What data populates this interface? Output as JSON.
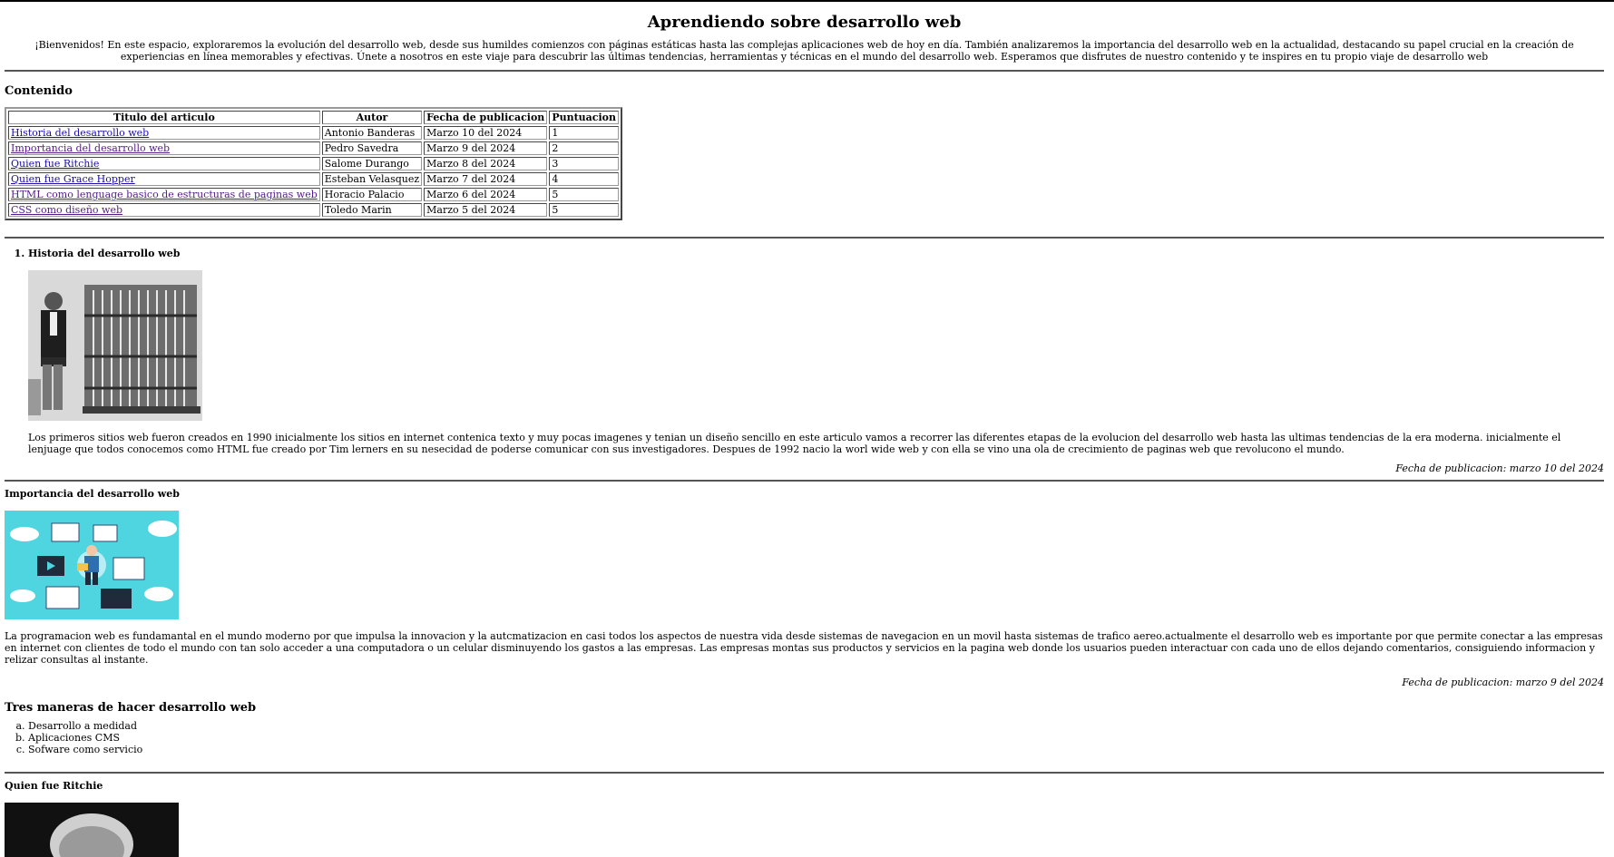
{
  "page": {
    "title": "Aprendiendo sobre desarrollo web",
    "intro": "¡Bienvenidos! En este espacio, exploraremos la evolución del desarrollo web, desde sus humildes comienzos con páginas estáticas hasta las complejas aplicaciones web de hoy en día. También analizaremos la importancia del desarrollo web en la actualidad, destacando su papel crucial en la creación de experiencias en línea memorables y efectivas. Únete a nosotros en este viaje para descubrir las últimas tendencias, herramientas y técnicas en el mundo del desarrollo web. Esperamos que disfrutes de nuestro contenido y te inspires en tu propio viaje de desarrollo web"
  },
  "contents": {
    "heading": "Contenido",
    "columns": [
      "Titulo del articulo",
      "Autor",
      "Fecha de publicacion",
      "Puntuacion"
    ],
    "rows": [
      {
        "title": "Historia del desarrollo web",
        "author": "Antonio Banderas",
        "date": "Marzo 10 del 2024",
        "score": "1"
      },
      {
        "title": "Importancia del desarrollo web",
        "author": "Pedro Savedra",
        "date": "Marzo 9 del 2024",
        "score": "2"
      },
      {
        "title": "Quien fue Ritchie",
        "author": "Salome Durango",
        "date": "Marzo 8 del 2024",
        "score": "3"
      },
      {
        "title": "Quien fue Grace Hopper",
        "author": "Esteban Velasquez",
        "date": "Marzo 7 del 2024",
        "score": "4"
      },
      {
        "title": "HTML como lenguage basico de estructuras de paginas web",
        "author": "Horacio Palacio",
        "date": "Marzo 6 del 2024",
        "score": "5"
      },
      {
        "title": "CSS como diseño web",
        "author": "Toledo Marin",
        "date": "Marzo 5 del 2024",
        "score": "5"
      }
    ]
  },
  "article1": {
    "heading": "Historia del desarrollo web",
    "body": "Los primeros sitios web fueron creados en 1990 inicialmente los sitios en internet contenica texto y muy pocas imagenes y tenian un diseño sencillo en este articulo vamos a recorrer las diferentes etapas de la evolucion del desarrollo web hasta las ultimas tendencias de la era moderna. inicialmente el lenjuage que todos conocemos como HTML fue creado por Tim lerners en su nesecidad de poderse comunicar con sus investigadores. Despues de 1992 nacio la worl wide web y con ella se vino una ola de crecimiento de paginas web que revolucono el mundo.",
    "date": "Fecha de publicacion: marzo 10 del 2024"
  },
  "article2": {
    "heading": "Importancia del desarrollo web",
    "body": "La programacion web es fundamantal en el mundo moderno por que impulsa la innovacion y la autcmatizacion en casi todos los aspectos de nuestra vida desde sistemas de navegacion en un movil hasta sistemas de trafico aereo.actualmente el desarrollo web es importante por que permite conectar a las empresas en internet con clientes de todo el mundo con tan solo acceder a una computadora o un celular disminuyendo los gastos a las empresas. Las empresas montas sus productos y servicios en la pagina web donde los usuarios pueden interactuar con cada uno de ellos dejando comentarios, consiguiendo informacion y relizar consultas al instante.",
    "date": "Fecha de publicacion: marzo 9 del 2024"
  },
  "ways": {
    "heading": "Tres maneras de hacer desarrollo web",
    "items": [
      "Desarrollo a medidad",
      "Aplicaciones CMS",
      "Sofware como servicio"
    ]
  },
  "article3": {
    "heading": "Quien fue Ritchie"
  }
}
